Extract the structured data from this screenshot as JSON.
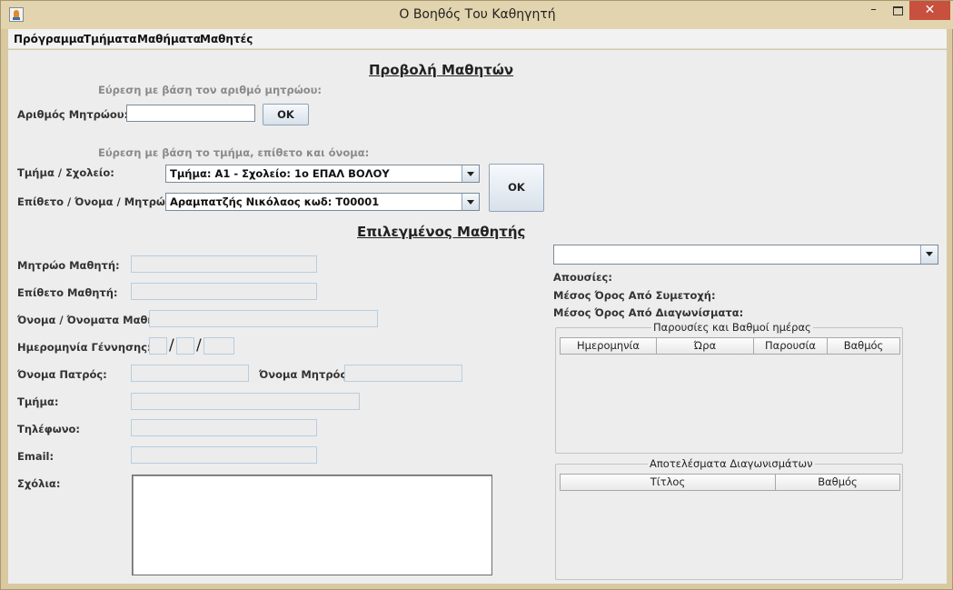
{
  "window": {
    "title": "Ο Βοηθός Του Καθηγητή",
    "controls": {
      "minimize": "–",
      "close": "✕"
    }
  },
  "menu": [
    "Πρόγραμμα",
    "Τμήματα",
    "Μαθήματα",
    "Μαθητές"
  ],
  "search": {
    "heading": "Προβολή Μαθητών",
    "by_registry_hint": "Εύρεση με βάση τον αριθμό μητρώου:",
    "registry_label": "Αριθμός Μητρώου:",
    "registry_value": "",
    "ok_label": "OK",
    "by_class_hint": "Εύρεση με βάση το τμήμα, επίθετο και όνομα:",
    "class_label": "Τμήμα / Σχολείο:",
    "class_value": "Τμήμα: Α1 - Σχολείο: 1ο ΕΠΑΛ ΒΟΛΟΥ",
    "student_label": "Επίθετο / Όνομα / Μητρώο:",
    "student_value": "Αραμπατζής Νικόλαος    κωδ: Τ00001",
    "ok2_label": "OK"
  },
  "selected": {
    "heading": "Επιλεγμένος Μαθητής",
    "fields": {
      "registry": "Μητρώο Μαθητή:",
      "surname": "Επίθετο Μαθητή:",
      "names": "Όνομα / Όνοματα Μαθητή:",
      "birthdate": "Ημερομηνία Γέννησης:",
      "father": "Όνομα Πατρός:",
      "mother": "Όνομα Μητρός:",
      "class": "Τμήμα:",
      "phone": "Τηλέφωνο:",
      "email": "Email:",
      "comments": "Σχόλια:"
    },
    "date_separator": "/"
  },
  "stats": {
    "course_select_value": "",
    "absences": "Απουσίες:",
    "avg_participation": "Μέσος Όρος Από Συμετοχή:",
    "avg_tests": "Μέσος Όρος Από Διαγωνίσματα:"
  },
  "attendance_table": {
    "title": "Παρουσίες και Βαθμοί ημέρας",
    "columns": [
      "Ημερομηνία",
      "Ώρα",
      "Παρουσία",
      "Βαθμός"
    ]
  },
  "tests_table": {
    "title": "Αποτελέσματα Διαγωνισμάτων",
    "columns": [
      "Τίτλος",
      "Βαθμός"
    ]
  }
}
